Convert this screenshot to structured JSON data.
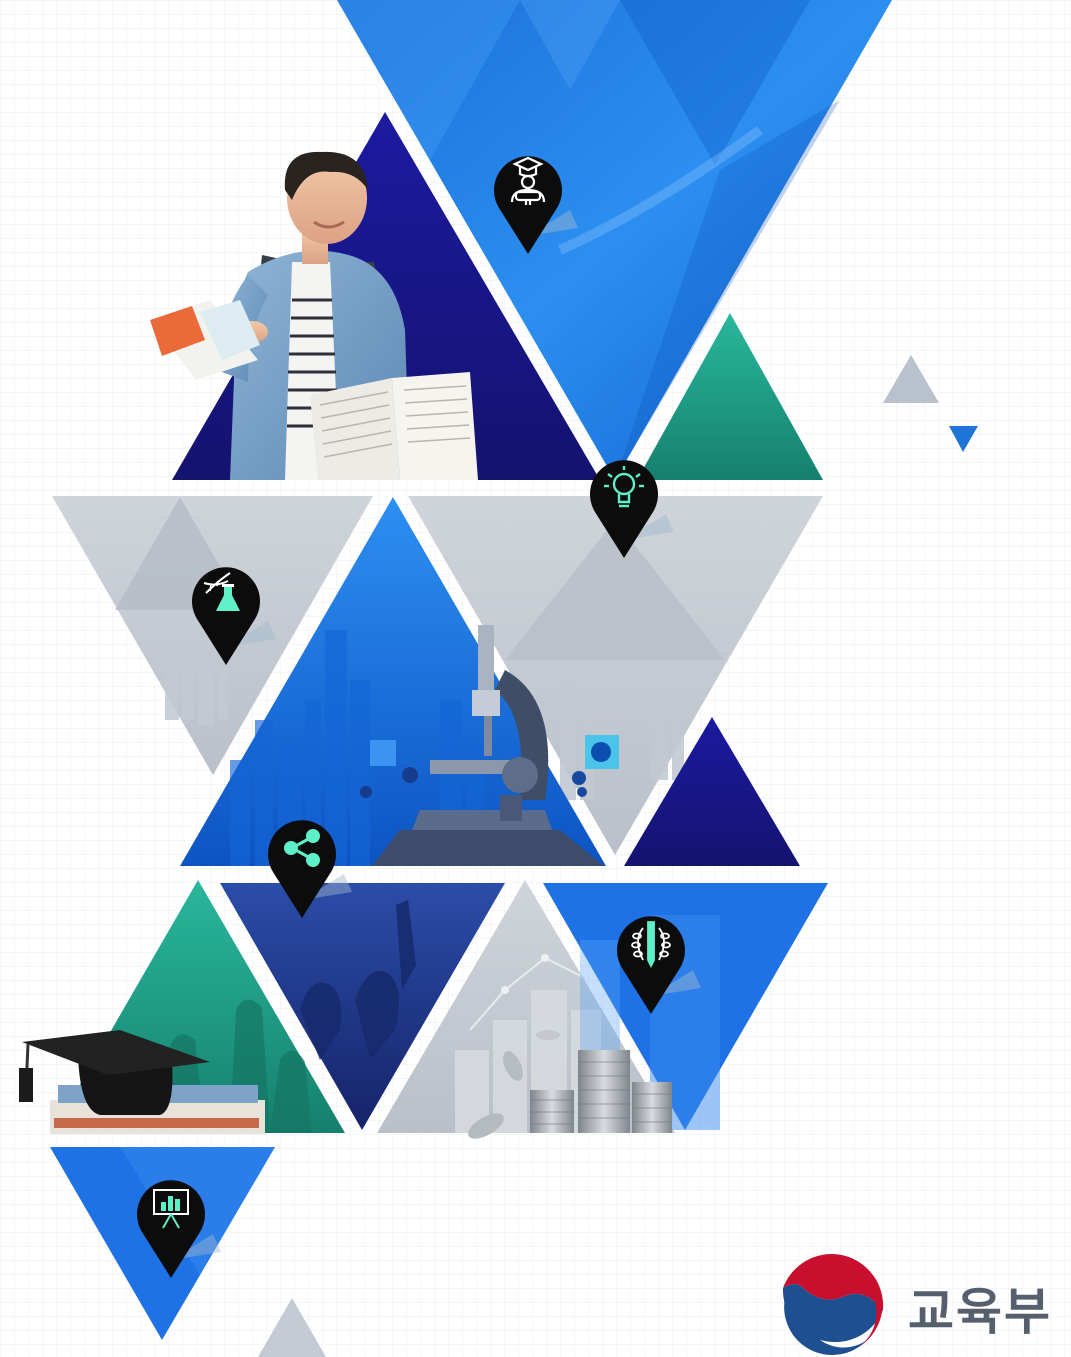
{
  "brand": {
    "name": "교육부",
    "colors": {
      "red": "#c8102e",
      "blue": "#1d4f91",
      "text": "#55606c"
    }
  },
  "theme": {
    "blue": "#1f7fe0",
    "navy": "#1b1d86",
    "teal": "#1fa88f",
    "gray": "#c9ced6"
  },
  "pins": [
    {
      "name": "graduate-pin",
      "icon": "graduate-icon",
      "icon_color": "#ffffff"
    },
    {
      "name": "lightbulb-pin",
      "icon": "lightbulb-icon",
      "icon_color": "#5ef0c6"
    },
    {
      "name": "science-pin",
      "icon": "dna-flask-icon",
      "icon_color": "#5ef0c6"
    },
    {
      "name": "share-pin",
      "icon": "share-icon",
      "icon_color": "#5ef0c6"
    },
    {
      "name": "award-pin",
      "icon": "laurel-pencil-icon",
      "icon_color": "#5ef0c6"
    },
    {
      "name": "presentation-pin",
      "icon": "presentation-chart-icon",
      "icon_color": "#5ef0c6"
    }
  ]
}
